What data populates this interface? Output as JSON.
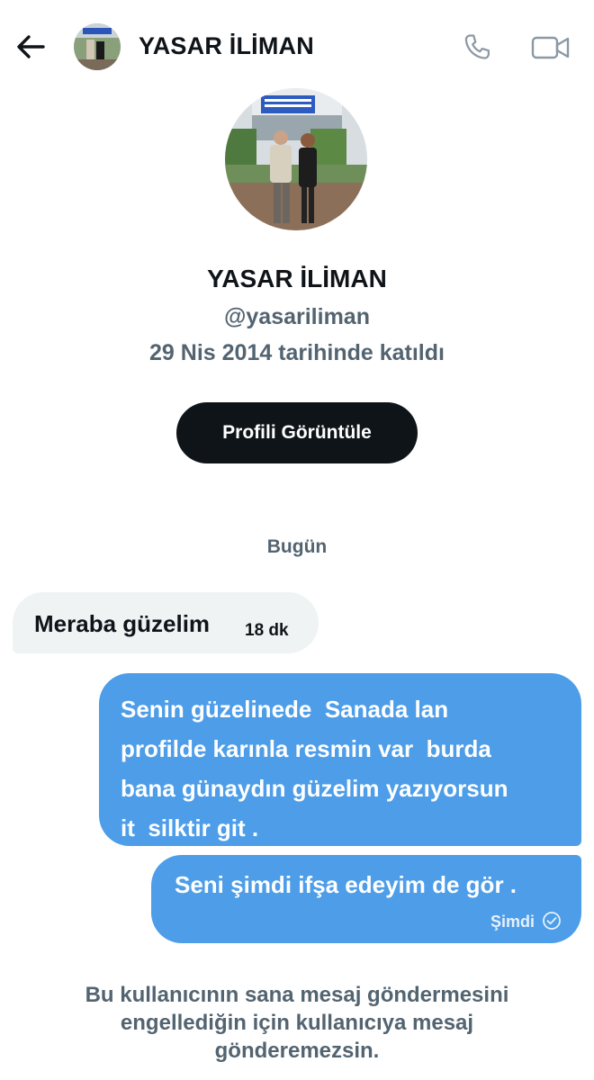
{
  "header": {
    "name": "YASAR İLİMAN",
    "back_icon": "arrow-left-icon",
    "call_icon": "phone-icon",
    "video_icon": "video-camera-icon"
  },
  "profile": {
    "name": "YASAR İLİMAN",
    "handle": "@yasariliman",
    "joined": "29 Nis 2014 tarihinde katıldı",
    "view_button": "Profili Görüntüle"
  },
  "conversation": {
    "day_label": "Bugün",
    "messages": [
      {
        "direction": "incoming",
        "text": "Meraba güzelim",
        "time": "18 dk"
      },
      {
        "direction": "outgoing",
        "lines": [
          "Senin güzelinede  Sanada lan",
          "profilde karınla resmin var  burda",
          "bana günaydın güzelim yazıyorsun",
          "it  silktir git ."
        ]
      },
      {
        "direction": "outgoing",
        "text": "Seni şimdi ifşa edeyim de gör .",
        "time": "Şimdi",
        "status_icon": "check-circle-icon"
      }
    ]
  },
  "footer": {
    "notice_lines": [
      "Bu kullanıcının sana mesaj göndermesini",
      "engellediğin için kullanıcıya mesaj",
      "gönderemezsin."
    ]
  },
  "colors": {
    "accent": "#4d9de8",
    "secondary_text": "#536471",
    "incoming_bubble": "#eff3f4",
    "button": "#0f1419"
  }
}
